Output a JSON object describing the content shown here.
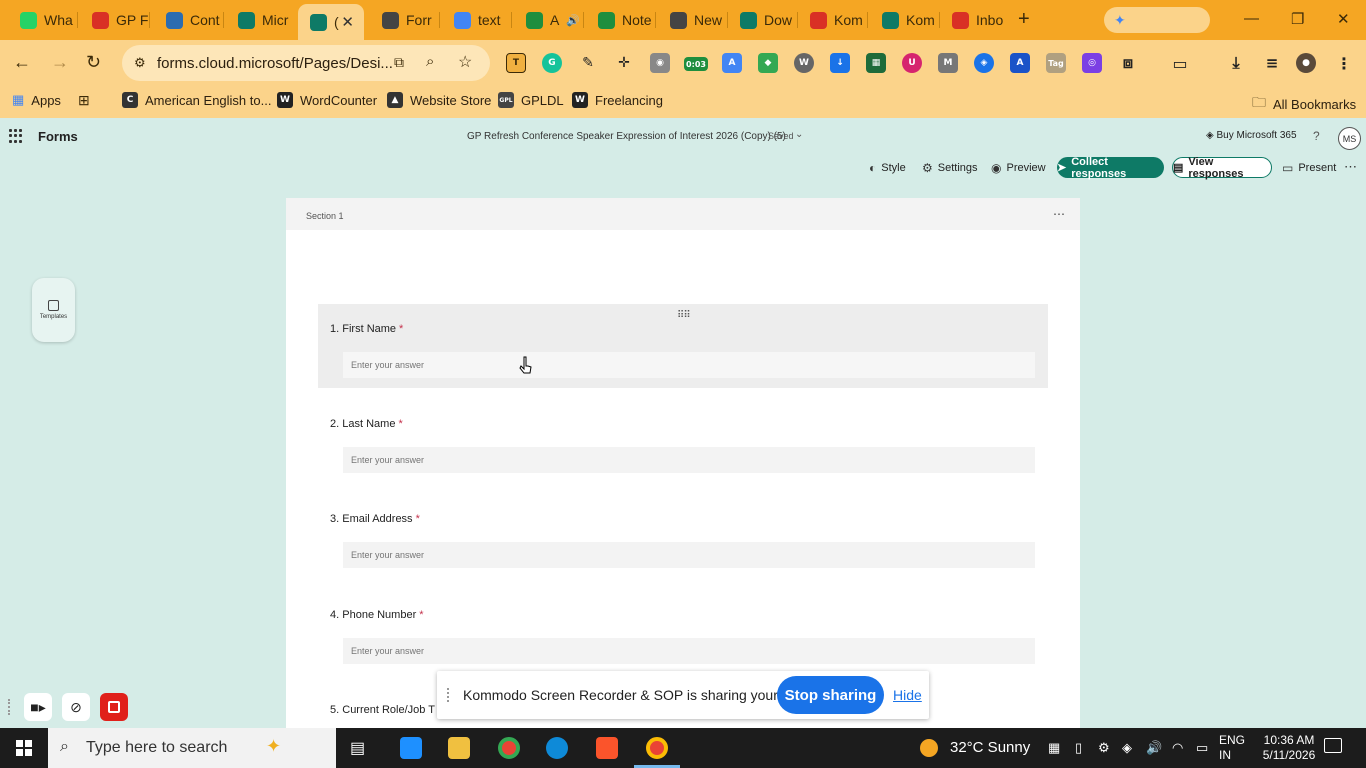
{
  "browser": {
    "tabs": [
      {
        "title": "Wha",
        "favicon_color": "#25d366",
        "icon": "whatsapp-icon"
      },
      {
        "title": "GP F",
        "favicon_color": "#d93025",
        "icon": "gmail-icon"
      },
      {
        "title": "Cont",
        "favicon_color": "#2b6cb0",
        "icon": "contact-icon"
      },
      {
        "title": "Micr",
        "favicon_color": "#0e7a66",
        "icon": "forms-icon"
      },
      {
        "title": "(",
        "favicon_color": "#0e7a66",
        "icon": "forms-icon",
        "active": true
      },
      {
        "title": "Forr",
        "favicon_color": "#444444",
        "icon": "openai-icon"
      },
      {
        "title": "text",
        "favicon_color": "#4285f4",
        "icon": "google-icon"
      },
      {
        "title": "A",
        "favicon_color": "#1e8e3e",
        "icon": "evernote-icon",
        "audio": true
      },
      {
        "title": "Note",
        "favicon_color": "#1e8e3e",
        "icon": "evernote-icon"
      },
      {
        "title": "New",
        "favicon_color": "#444444",
        "icon": "openai-icon"
      },
      {
        "title": "Dow",
        "favicon_color": "#0e7a66",
        "icon": "edge-icon"
      },
      {
        "title": "Kom",
        "favicon_color": "#d93025",
        "icon": "kommodo-icon"
      },
      {
        "title": "Kom",
        "favicon_color": "#0e7a66",
        "icon": "edge-icon"
      },
      {
        "title": "Inbo",
        "favicon_color": "#d93025",
        "icon": "gmail-icon"
      }
    ],
    "url": "forms.cloud.microsoft/Pages/Desi...",
    "extension_badge": "0:03",
    "bookmarks": [
      {
        "label": "Apps",
        "color": "#4285f4"
      },
      {
        "label": "",
        "color": "#3b2a08"
      },
      {
        "label": "American English to...",
        "color": "#333333"
      },
      {
        "label": "WordCounter",
        "color": "#222222"
      },
      {
        "label": "Website Store",
        "color": "#222222"
      },
      {
        "label": "GPLDL",
        "color": "#222222"
      },
      {
        "label": "Freelancing",
        "color": "#222222"
      }
    ],
    "all_bookmarks": "All Bookmarks"
  },
  "forms": {
    "app_name": "Forms",
    "form_title": "GP Refresh Conference Speaker Expression of Interest 2026 (Copy) (5)",
    "saved_status": "Saved",
    "buy_label": "Buy Microsoft 365",
    "help_label": "?",
    "avatar_initials": "MS",
    "commands": {
      "style": "Style",
      "settings": "Settings",
      "preview": "Preview",
      "collect": "Collect responses",
      "view": "View responses",
      "present": "Present"
    },
    "templates_label": "Templates",
    "section_label": "Section 1",
    "questions": [
      {
        "number": "1.",
        "label": "First Name",
        "required": "*",
        "placeholder": "Enter your answer",
        "active": true
      },
      {
        "number": "2.",
        "label": "Last Name",
        "required": "*",
        "placeholder": "Enter your answer"
      },
      {
        "number": "3.",
        "label": "Email Address",
        "required": "*",
        "placeholder": "Enter your answer"
      },
      {
        "number": "4.",
        "label": "Phone Number",
        "required": "*",
        "placeholder": "Enter your answer"
      },
      {
        "number": "5.",
        "label": "Current Role/Job T",
        "required": "",
        "placeholder": ""
      }
    ]
  },
  "share": {
    "message": "Kommodo Screen Recorder & SOP is sharing your screen.",
    "stop_label": "Stop sharing",
    "hide_label": "Hide"
  },
  "taskbar": {
    "search_placeholder": "Type here to search",
    "weather": "32°C  Sunny",
    "language": "ENG",
    "region": "IN",
    "time": "10:36 AM",
    "date": "5/11/2026"
  }
}
